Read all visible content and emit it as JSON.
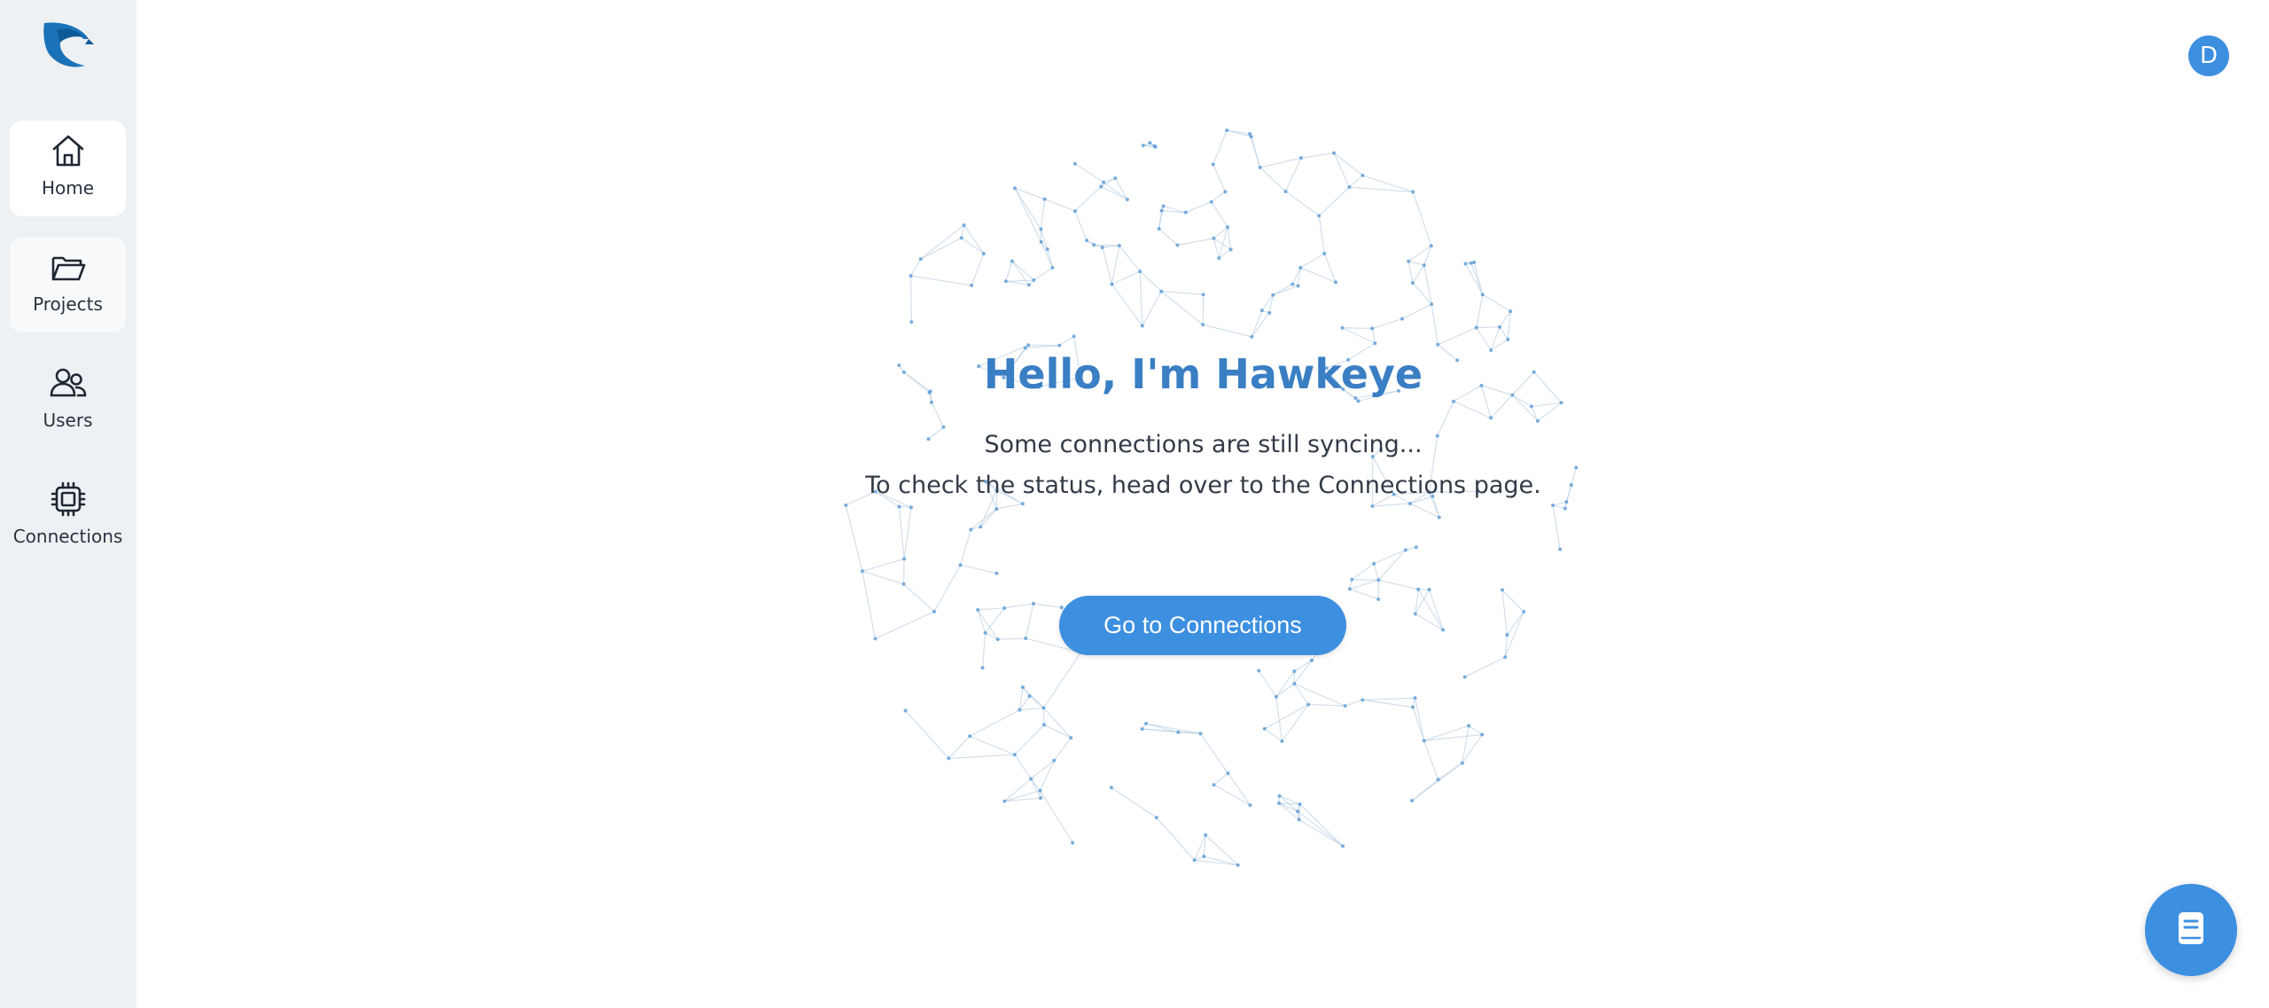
{
  "sidebar": {
    "logo_icon": "hawk-logo-icon",
    "items": [
      {
        "label": "Home",
        "icon": "home-icon"
      },
      {
        "label": "Projects",
        "icon": "folder-icon"
      },
      {
        "label": "Users",
        "icon": "users-icon"
      },
      {
        "label": "Connections",
        "icon": "chip-icon"
      }
    ]
  },
  "header": {
    "avatar_initial": "D"
  },
  "hero": {
    "title": "Hello, I'm Hawkeye",
    "line1": "Some connections are still syncing...",
    "line2": "To check the status, head over to the Connections page.",
    "button_label": "Go to Connections"
  },
  "fab": {
    "icon": "book-icon"
  },
  "colors": {
    "accent": "#3d8fe0",
    "title": "#3a7ec4",
    "sidebar_bg": "#eef1f4",
    "network": "#b9cfe2"
  }
}
